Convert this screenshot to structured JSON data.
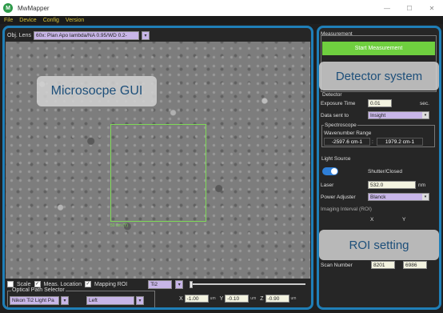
{
  "app": {
    "title": "MwMapper",
    "logo_letter": "M"
  },
  "window_controls": {
    "minimize": "—",
    "maximize": "☐",
    "close": "✕"
  },
  "menu": [
    "File",
    "Device",
    "Config",
    "Version"
  ],
  "left_panel": {
    "obj_lens_label": "Obj. Lens",
    "obj_lens_value": "60x: Plan Apo lambda/NA 0.95/WD 0.2-",
    "overlay_label": "Microsocpe GUI",
    "roi_tag": "50 um (Y)"
  },
  "bottom_controls": {
    "scale": {
      "label": "Scale",
      "checked": false
    },
    "meas_location": {
      "label": "Meas. Location",
      "checked": true
    },
    "mapping_roi": {
      "label": "Mapping ROI",
      "checked": true
    },
    "device_select": "Ti2",
    "slider_value": 0
  },
  "optical_path": {
    "title": "Optical Path Selector",
    "path_value": "Nikon Ti2 Light Pa",
    "side_value": "Left"
  },
  "position": {
    "x_label": "X",
    "x_value": "-1.00",
    "y_label": "Y",
    "y_value": "-0.10",
    "z_label": "Z",
    "z_value": "-0.90",
    "unit": "um"
  },
  "right_panel": {
    "measurement_title": "Measurement",
    "start_button": "Start Measurement",
    "detector_overlay": "Detector system",
    "detector_title": "Detector",
    "exposure_label": "Exposure Time",
    "exposure_value": "0.01",
    "exposure_unit": "sec.",
    "data_sent_label": "Data sent to",
    "data_sent_value": "Insight",
    "spectroscope_title": "Spectroscope",
    "wavenumber_label": "Wavenumber Range",
    "range_min": "-2597.6 cm-1",
    "range_sep": ":",
    "range_max": "1979.2 cm-1",
    "light_source_title": "Light Source",
    "shutter_label": "Shutter/Closed",
    "laser_label": "Laser",
    "laser_value": "532.0",
    "laser_unit": "nm",
    "power_label": "Power Adjuster",
    "power_value": "Blanck",
    "roi_partial_label": "Imaging Interval (ROI)",
    "roi_x_header": "X",
    "roi_y_header": "Y",
    "roi_overlay": "ROI setting",
    "scan_number_label": "Scan Number",
    "scan_x": "8201",
    "scan_y": "6986"
  }
}
